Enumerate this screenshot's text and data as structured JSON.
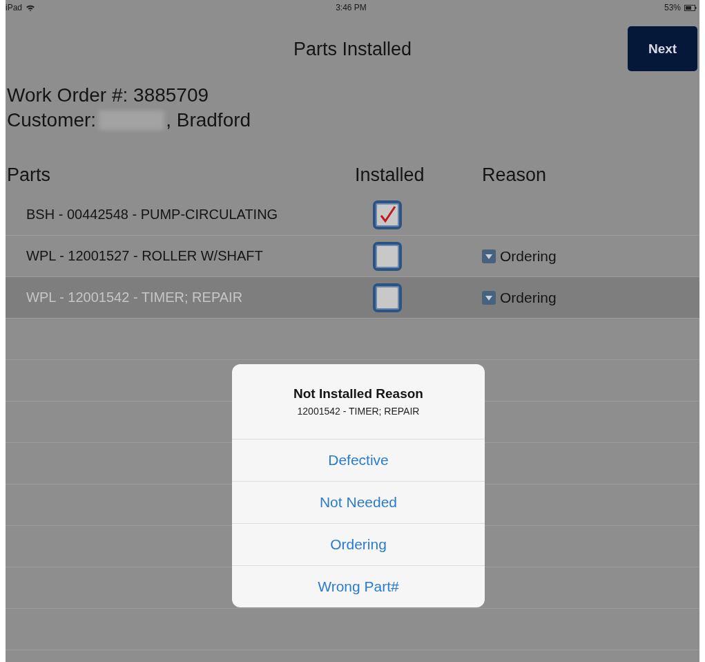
{
  "status_bar": {
    "carrier": "iPad",
    "time": "3:46 PM",
    "battery": "53%"
  },
  "nav": {
    "title": "Parts Installed",
    "next_button": "Next"
  },
  "work_order": {
    "number_line": "Work Order #: 3885709",
    "customer_label": "Customer:",
    "customer_city": ", Bradford"
  },
  "columns": [
    "Parts",
    "Installed",
    "Reason"
  ],
  "rows": [
    {
      "part": "BSH - 00442548 - PUMP-CIRCULATING",
      "installed": true,
      "selected": false
    },
    {
      "part": "WPL - 12001527 - ROLLER W/SHAFT",
      "installed": false,
      "reason": "Ordering",
      "selected": false
    },
    {
      "part": "WPL - 12001542 - TIMER; REPAIR",
      "installed": false,
      "reason": "Ordering",
      "selected": true
    }
  ],
  "dialog": {
    "title": "Not Installed Reason",
    "subtitle": "12001542 - TIMER; REPAIR",
    "options": [
      "Defective",
      "Not Needed",
      "Ordering",
      "Wrong Part#"
    ]
  }
}
